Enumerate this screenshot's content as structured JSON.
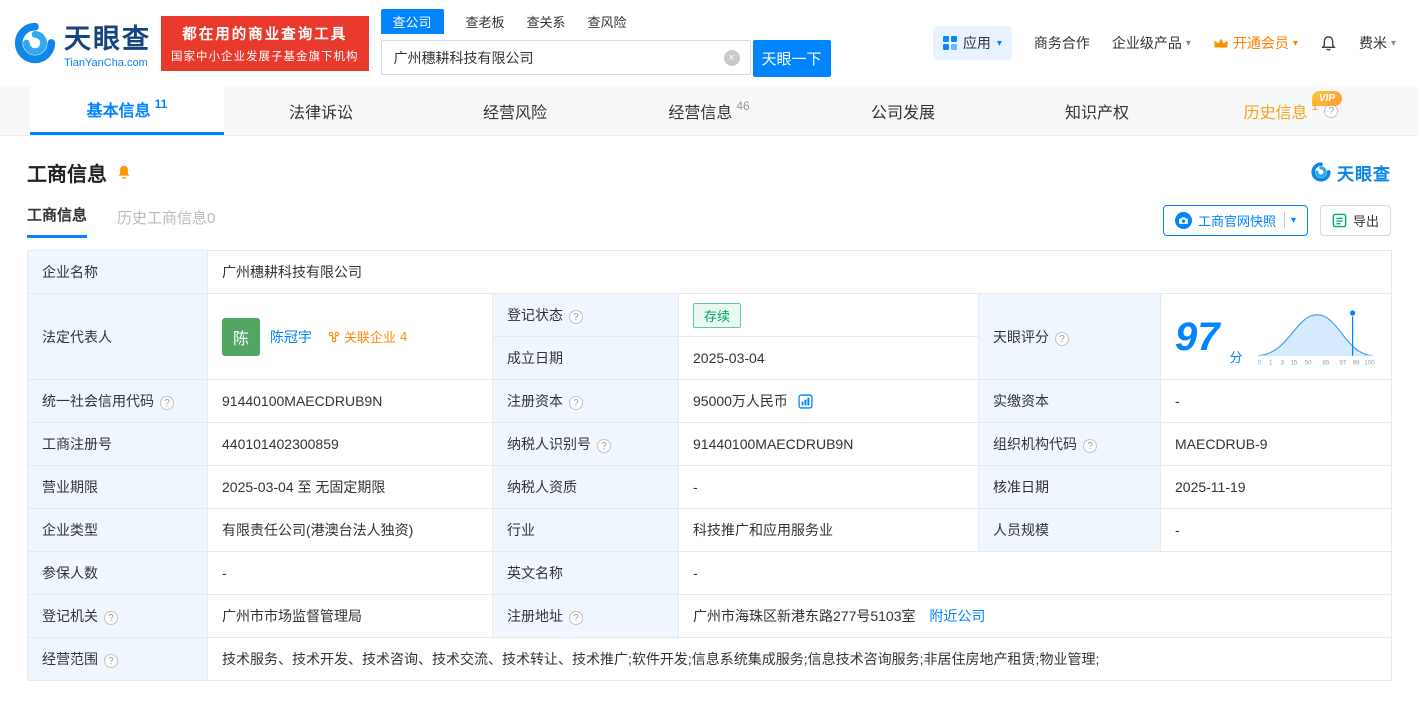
{
  "brand": {
    "name": "天眼查",
    "domain": "TianYanCha.com",
    "slogan1": "都在用的商业查询工具",
    "slogan2": "国家中小企业发展子基金旗下机构"
  },
  "search": {
    "tabs": [
      {
        "label": "查公司",
        "active": true
      },
      {
        "label": "查老板",
        "active": false
      },
      {
        "label": "查关系",
        "active": false
      },
      {
        "label": "查风险",
        "active": false
      }
    ],
    "value": "广州穗耕科技有限公司",
    "submit": "天眼一下"
  },
  "topnav": {
    "apps": "应用",
    "business": "商务合作",
    "enterprise": "企业级产品",
    "vip": "开通会员",
    "user": "费米"
  },
  "tabs": [
    {
      "label": "基本信息",
      "count": "11"
    },
    {
      "label": "法律诉讼",
      "count": ""
    },
    {
      "label": "经营风险",
      "count": ""
    },
    {
      "label": "经营信息",
      "count": "46"
    },
    {
      "label": "公司发展",
      "count": ""
    },
    {
      "label": "知识产权",
      "count": ""
    },
    {
      "label": "历史信息",
      "count": "1",
      "vip": "VIP"
    }
  ],
  "section": {
    "title": "工商信息",
    "watermark": "天眼查",
    "subtab_active": "工商信息",
    "subtab_history": "历史工商信息0",
    "snapshot": "工商官网快照",
    "export": "导出"
  },
  "score": {
    "value": "97",
    "unit": "分",
    "axis": [
      "0",
      "1",
      "3",
      "15",
      "50",
      "85",
      "97",
      "99",
      "100"
    ]
  },
  "table": {
    "labels": {
      "company_name": "企业名称",
      "legal_rep": "法定代表人",
      "reg_status": "登记状态",
      "establish_date": "成立日期",
      "tyc_score": "天眼评分",
      "credit_code": "统一社会信用代码",
      "reg_capital": "注册资本",
      "paid_capital": "实缴资本",
      "reg_number": "工商注册号",
      "taxpayer_id": "纳税人识别号",
      "org_code": "组织机构代码",
      "business_term": "营业期限",
      "taxpayer_quality": "纳税人资质",
      "approval_date": "核准日期",
      "company_type": "企业类型",
      "industry": "行业",
      "staff_size": "人员规模",
      "insured_count": "参保人数",
      "english_name": "英文名称",
      "reg_authority": "登记机关",
      "reg_address": "注册地址",
      "business_scope": "经营范围"
    },
    "values": {
      "company_name": "广州穗耕科技有限公司",
      "legal_rep_avatar": "陈",
      "legal_rep_name": "陈冠宇",
      "related_label": "关联企业",
      "related_count": "4",
      "reg_status": "存续",
      "establish_date": "2025-03-04",
      "credit_code": "91440100MAECDRUB9N",
      "reg_capital": "95000万人民币",
      "paid_capital": "-",
      "reg_number": "440101402300859",
      "taxpayer_id": "91440100MAECDRUB9N",
      "org_code": "MAECDRUB-9",
      "business_term": "2025-03-04 至 无固定期限",
      "taxpayer_quality": "-",
      "approval_date": "2025-11-19",
      "company_type": "有限责任公司(港澳台法人独资)",
      "industry": "科技推广和应用服务业",
      "staff_size": "-",
      "insured_count": "-",
      "english_name": "-",
      "reg_authority": "广州市市场监督管理局",
      "reg_address": "广州市海珠区新港东路277号5103室",
      "nearby_link": "附近公司",
      "business_scope": "技术服务、技术开发、技术咨询、技术交流、技术转让、技术推广;软件开发;信息系统集成服务;信息技术咨询服务;非居住房地产租赁;物业管理;"
    }
  },
  "icons": {
    "clear": "×",
    "caret": "▾",
    "help": "?"
  },
  "colors": {
    "brand_blue": "#0084ff",
    "banner_red": "#e8392c",
    "status_green": "#00a364",
    "vip_gold": "#f9a21b",
    "related_orange": "#ff8a00",
    "label_cell_bg": "#eff6fd"
  }
}
